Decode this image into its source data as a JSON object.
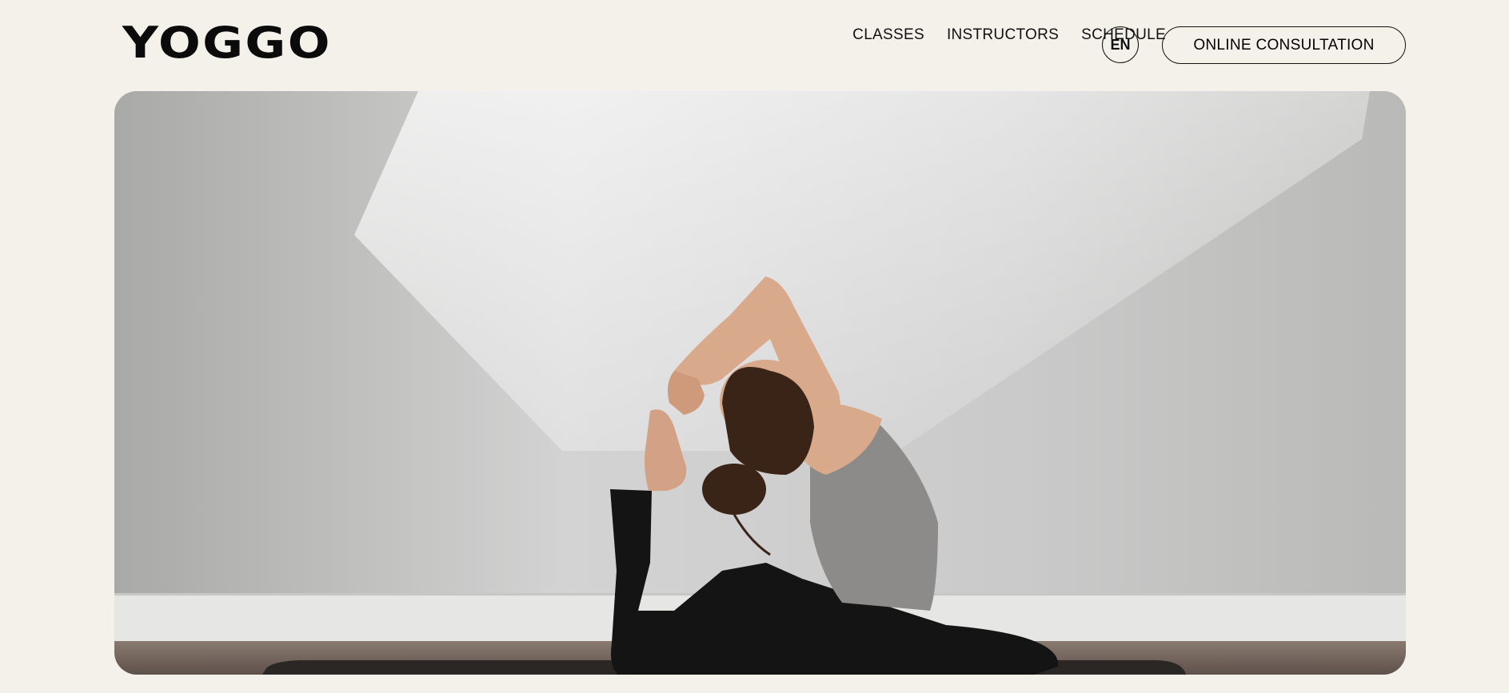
{
  "brand": {
    "logo_text": "YOGGO"
  },
  "nav": {
    "links": [
      {
        "label": "CLASSES"
      },
      {
        "label": "INSTRUCTORS"
      },
      {
        "label": "SCHEDULE"
      }
    ],
    "language": "EN",
    "cta_label": "ONLINE CONSULTATION"
  },
  "hero": {
    "image_subject": "yoga-pose-photo",
    "colors": {
      "background": "#f3f1ea",
      "wall": "#d6d6d6",
      "floor": "#7a6a62",
      "mat": "#2a2725",
      "clothing_top": "#8d8b89",
      "clothing_bottom": "#141414",
      "skin": "#d9a98b",
      "hair": "#3a2418"
    }
  }
}
